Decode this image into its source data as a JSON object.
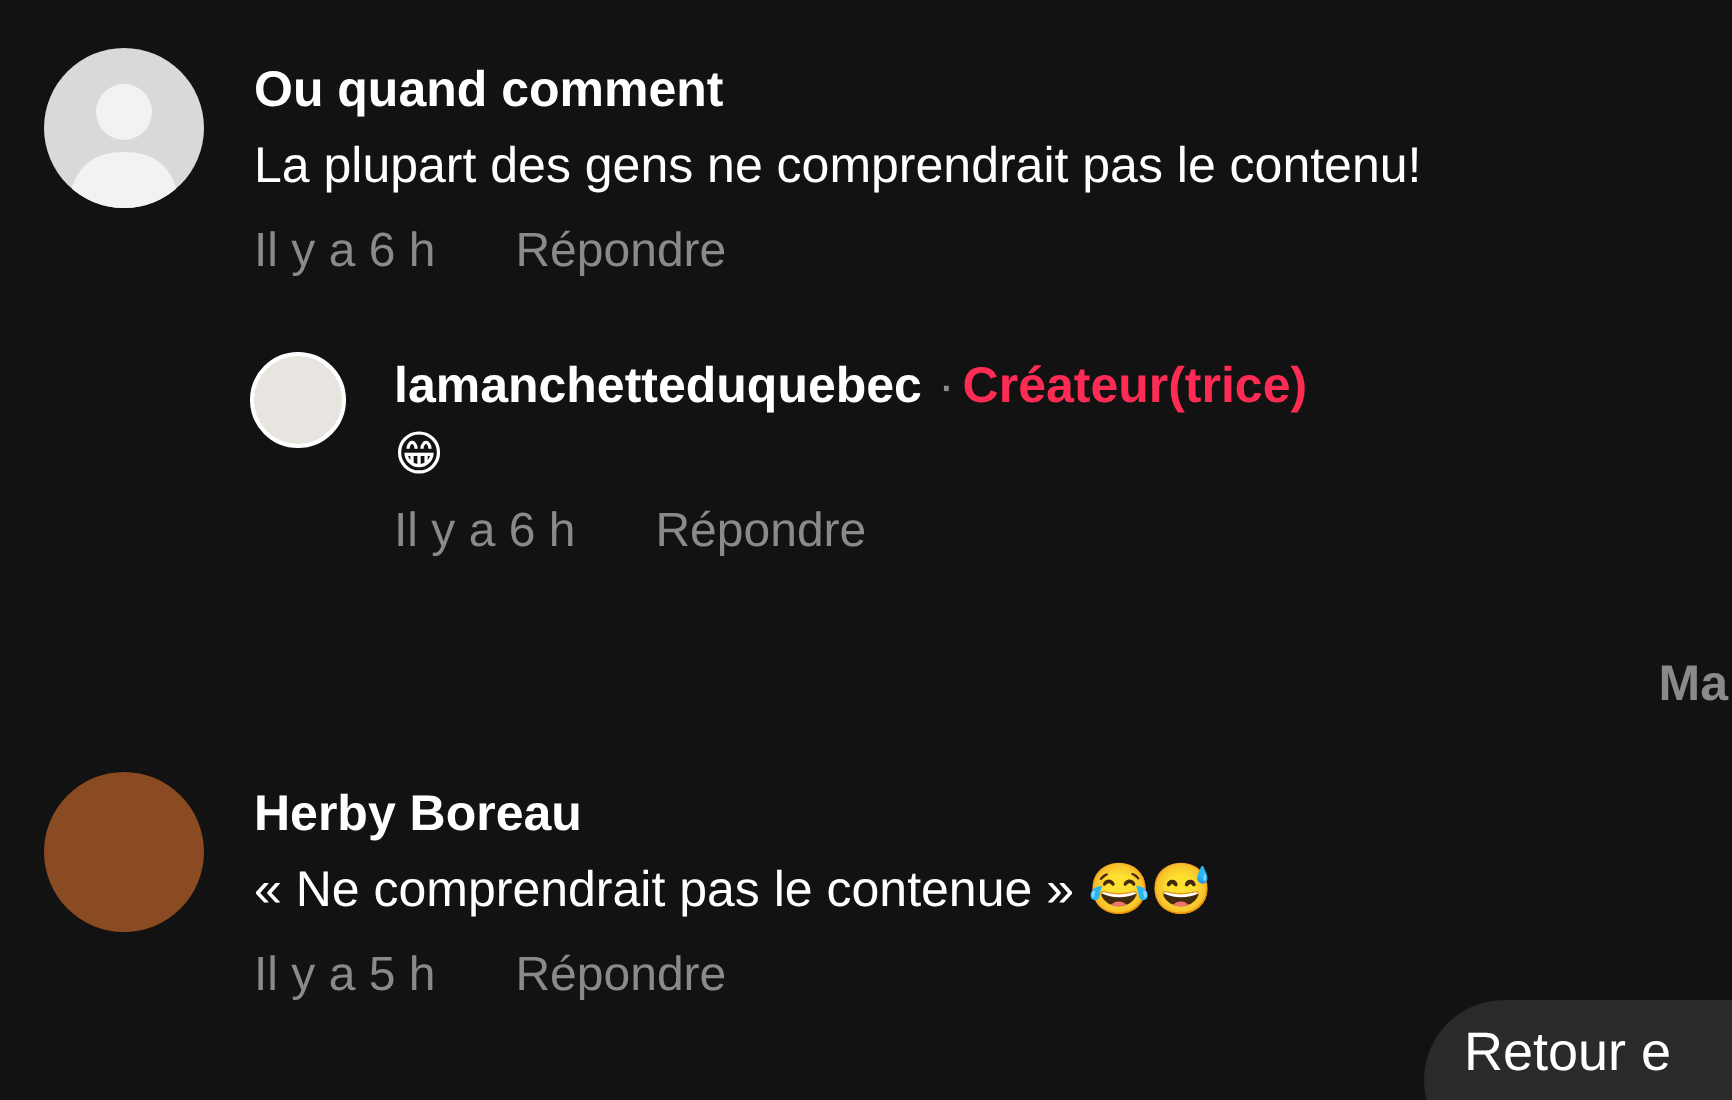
{
  "comments": [
    {
      "author": "Ou quand comment",
      "avatar": {
        "kind": "silhouette"
      },
      "text": "La plupart des gens ne comprendrait pas le contenu!",
      "time": "Il y a 6 h",
      "reply_label": "Répondre",
      "replies": [
        {
          "author": "lamanchetteduquebec",
          "separator": "·",
          "badge": "Créateur(trice)",
          "avatar": {
            "kind": "photo"
          },
          "text": "😁",
          "time": "Il y a 6 h",
          "reply_label": "Répondre"
        }
      ],
      "hide_label": "Ma"
    },
    {
      "author": "Herby Boreau",
      "avatar": {
        "kind": "photo"
      },
      "text": "« Ne comprendrait pas le contenue » 😂😅",
      "time": "Il y a 5 h",
      "reply_label": "Répondre"
    }
  ],
  "back_button": "Retour e"
}
